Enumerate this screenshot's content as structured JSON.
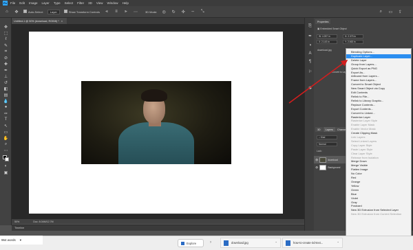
{
  "menubar": {
    "logo": "Ps",
    "items": [
      "File",
      "Edit",
      "Image",
      "Layer",
      "Type",
      "Select",
      "Filter",
      "3D",
      "View",
      "Window",
      "Help"
    ]
  },
  "options": {
    "auto_select": "Auto-Select:",
    "layer": "Layer",
    "show_transform": "Show Transform Controls",
    "mode": "3D Mode:"
  },
  "document": {
    "tab": "Untitled-1 @ 50% (download, RGB/8) *",
    "zoom": "50%",
    "doc_info": "Doc: 8.04M/12.7M"
  },
  "timeline": {
    "label": "Timeline"
  },
  "properties": {
    "tab": "Properties",
    "type": "Embedded Smart Object",
    "w_label": "W:",
    "w_value": "4.257 in",
    "h_label": "H:",
    "h_value": "2.373 in",
    "x_label": "X:",
    "x_value": "2.143 in",
    "y_label": "Y:",
    "y_value": "2.063 in",
    "file": "download.jpg",
    "convert": "Convert to Layers"
  },
  "layers_panel": {
    "tabs": [
      "3D",
      "Layers",
      "Channels"
    ],
    "kind": "Kind",
    "blend": "Normal",
    "lock": "Lock:",
    "layers": [
      "download",
      "Background"
    ]
  },
  "context_menu": {
    "items": [
      {
        "label": "Blending Options...",
        "state": "normal"
      },
      {
        "label": "Duplicate Layer...",
        "state": "highlighted"
      },
      {
        "label": "Delete Layer",
        "state": "normal"
      },
      {
        "label": "Group from Layers...",
        "state": "normal"
      },
      {
        "label": "",
        "state": "sep"
      },
      {
        "label": "Quick Export as PNG",
        "state": "normal"
      },
      {
        "label": "Export As...",
        "state": "normal"
      },
      {
        "label": "",
        "state": "sep"
      },
      {
        "label": "Artboard from Layers...",
        "state": "normal"
      },
      {
        "label": "Frame from Layers...",
        "state": "normal"
      },
      {
        "label": "",
        "state": "sep"
      },
      {
        "label": "Convert to Smart Object",
        "state": "normal"
      },
      {
        "label": "New Smart Object via Copy",
        "state": "normal"
      },
      {
        "label": "Edit Contents",
        "state": "normal"
      },
      {
        "label": "Relink to File...",
        "state": "normal"
      },
      {
        "label": "Relink to Library Graphic...",
        "state": "normal"
      },
      {
        "label": "Replace Contents...",
        "state": "normal"
      },
      {
        "label": "Export Contents...",
        "state": "normal"
      },
      {
        "label": "Convert to Linked...",
        "state": "normal"
      },
      {
        "label": "",
        "state": "sep"
      },
      {
        "label": "Rasterize Layer",
        "state": "normal"
      },
      {
        "label": "Rasterize Layer Style",
        "state": "disabled"
      },
      {
        "label": "",
        "state": "sep"
      },
      {
        "label": "Enable Layer Mask",
        "state": "disabled"
      },
      {
        "label": "Enable Vector Mask",
        "state": "disabled"
      },
      {
        "label": "Create Clipping Mask",
        "state": "normal"
      },
      {
        "label": "",
        "state": "sep"
      },
      {
        "label": "Link Layers",
        "state": "disabled"
      },
      {
        "label": "Select Linked Layers",
        "state": "disabled"
      },
      {
        "label": "",
        "state": "sep"
      },
      {
        "label": "Copy Layer Style",
        "state": "disabled"
      },
      {
        "label": "Paste Layer Style",
        "state": "disabled"
      },
      {
        "label": "Clear Layer Style",
        "state": "disabled"
      },
      {
        "label": "",
        "state": "sep"
      },
      {
        "label": "Release from Isolation",
        "state": "disabled"
      },
      {
        "label": "",
        "state": "sep"
      },
      {
        "label": "Merge Down",
        "state": "normal"
      },
      {
        "label": "Merge Visible",
        "state": "normal"
      },
      {
        "label": "Flatten Image",
        "state": "normal"
      },
      {
        "label": "",
        "state": "sep"
      },
      {
        "label": "No Color",
        "state": "normal"
      },
      {
        "label": "Red",
        "state": "normal"
      },
      {
        "label": "Orange",
        "state": "normal"
      },
      {
        "label": "Yellow",
        "state": "normal"
      },
      {
        "label": "Green",
        "state": "normal"
      },
      {
        "label": "Blue",
        "state": "normal"
      },
      {
        "label": "Violet",
        "state": "normal"
      },
      {
        "label": "Gray",
        "state": "normal"
      },
      {
        "label": "",
        "state": "sep"
      },
      {
        "label": "Postcard",
        "state": "normal"
      },
      {
        "label": "New 3D Extrusion from Selected Layer",
        "state": "normal"
      },
      {
        "label": "New 3D Extrusion from Current Selection",
        "state": "disabled"
      }
    ]
  },
  "taskbar": {
    "words": "964 words",
    "explore": "Explore",
    "downloads": [
      "download.jpg",
      "how-to-create-3d-text..."
    ]
  },
  "colors": {
    "accent": "#2b8ef0",
    "arrow": "#d21e1e",
    "ps_blue": "#31a8ff"
  }
}
